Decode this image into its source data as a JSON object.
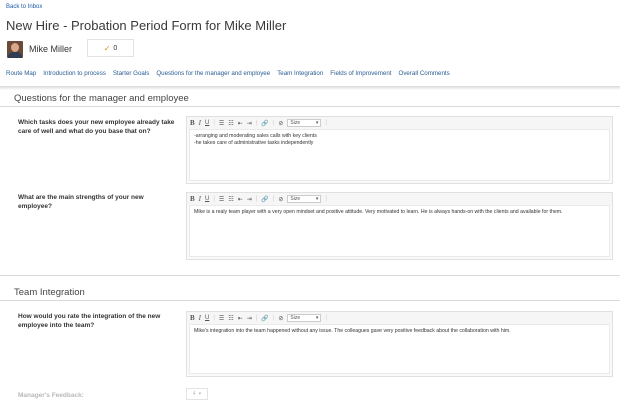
{
  "nav": {
    "back_label": "Back to Inbox"
  },
  "form": {
    "title": "New Hire - Probation Period Form for Mike Miller"
  },
  "employee": {
    "name": "Mike Miller",
    "status_count": "0"
  },
  "tabs": [
    "Route Map",
    "Introduction to process",
    "Starter Goals",
    "Questions for the manager and employee",
    "Team Integration",
    "Fields of Improvement",
    "Overall Comments"
  ],
  "toolbar": {
    "bold": "B",
    "italic": "I",
    "underline": "U",
    "size_label": "Size"
  },
  "sections": {
    "questions": {
      "heading": "Questions for the manager and employee",
      "q1": {
        "label": "Which tasks does your new employee already take care of well and what do you base that on?",
        "lines": [
          "-arranging and moderating sales calls with key clients",
          "-he takes care of administrative tasks independently"
        ]
      },
      "q2": {
        "label": "What are the main strengths of your new employee?",
        "answer": "Mike is a realy team player with a very open mindset and positive attitude. Very motivated to learn. He is always hands-on with the clients and available for them."
      }
    },
    "team": {
      "heading": "Team Integration",
      "q3": {
        "label": "How would you rate the integration of the new employee into the team?",
        "answer": "Mike's integration into the team happened without any issue. The colleagues gave very positive feedback about the collaboration with him."
      }
    }
  },
  "feedback": {
    "label": "Manager's Feedback:",
    "value": "4"
  },
  "colors": {
    "link": "#1a5aa6",
    "tab": "#2a5d94",
    "check": "#e68a2e"
  },
  "icons": [
    "check-icon",
    "bold-icon",
    "italic-icon",
    "underline-icon",
    "bullet-list-icon",
    "numbered-list-icon",
    "outdent-icon",
    "indent-icon",
    "link-icon",
    "unlink-icon",
    "dropdown-chevron-icon"
  ]
}
